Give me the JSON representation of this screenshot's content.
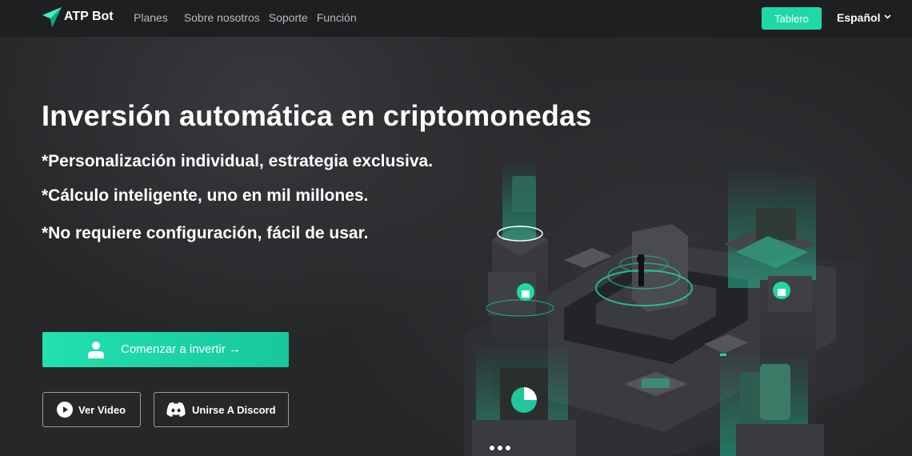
{
  "brand": {
    "name": "ATP Bot",
    "accent": "#1fd8a8"
  },
  "nav": {
    "links": [
      "Planes",
      "Sobre nosotros",
      "Soporte",
      "Función"
    ],
    "dashboard_button": "Tablero",
    "language": "Español"
  },
  "hero": {
    "title": "Inversión automática en criptomonedas",
    "features": [
      "*Personalización individual, estrategia exclusiva.",
      "*Cálculo inteligente, uno en mil millones.",
      "*No requiere configuración, fácil de usar."
    ],
    "start_button": "Comenzar a invertir →",
    "video_button": "Ver Video",
    "discord_button": "Unirse A Discord"
  },
  "icons": {
    "logo": "paper-plane-logo-icon",
    "language_chevron": "chevron-down-icon",
    "start": "user-icon",
    "video": "play-circle-icon",
    "discord": "discord-icon"
  }
}
